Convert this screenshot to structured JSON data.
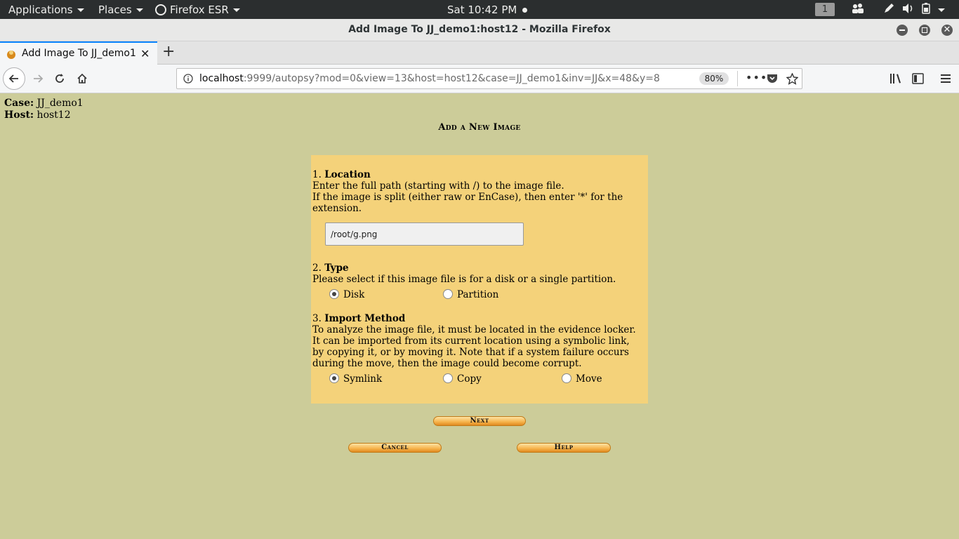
{
  "system_bar": {
    "applications": "Applications",
    "places": "Places",
    "firefox": "Firefox ESR",
    "clock": "Sat 10:42 PM",
    "workspace": "1"
  },
  "window": {
    "title": "Add Image To JJ_demo1:host12 - Mozilla Firefox"
  },
  "tab": {
    "title": "Add Image To JJ_demo1:host12"
  },
  "url": {
    "host": "localhost",
    "rest": ":9999/autopsy?mod=0&view=13&host=host12&case=JJ_demo1&inv=JJ&x=48&y=8",
    "zoom": "80%"
  },
  "case_info": {
    "case_label": "Case:",
    "case_value": "JJ_demo1",
    "host_label": "Host:",
    "host_value": "host12"
  },
  "page_title": "Add a New Image",
  "location": {
    "number": "1.",
    "heading": "Location",
    "line1": "Enter the full path (starting with /) to the image file.",
    "line2": "If the image is split (either raw or EnCase), then enter '*' for the extension.",
    "path_value": "/root/g.png"
  },
  "type": {
    "number": "2.",
    "heading": "Type",
    "description": "Please select if this image file is for a disk or a single partition.",
    "options": [
      "Disk",
      "Partition"
    ],
    "selected": "Disk"
  },
  "import": {
    "number": "3.",
    "heading": "Import Method",
    "description": "To analyze the image file, it must be located in the evidence locker. It can be imported from its current location using a symbolic link, by copying it, or by moving it. Note that if a system failure occurs during the move, then the image could become corrupt.",
    "options": [
      "Symlink",
      "Copy",
      "Move"
    ],
    "selected": "Symlink"
  },
  "buttons": {
    "next": "Next",
    "cancel": "Cancel",
    "help": "Help"
  }
}
